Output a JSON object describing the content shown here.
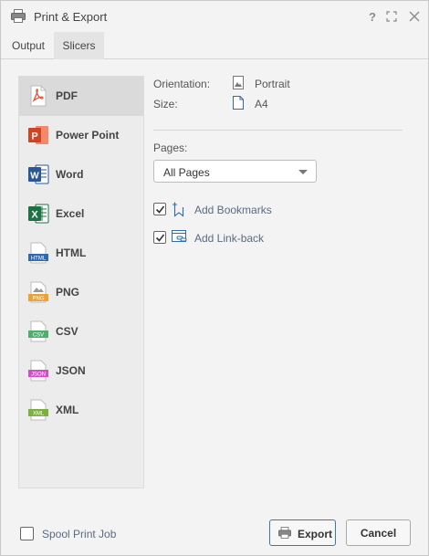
{
  "window": {
    "title": "Print & Export",
    "help_label": "?"
  },
  "tabs": [
    {
      "label": "Output"
    },
    {
      "label": "Slicers"
    }
  ],
  "formats": [
    {
      "label": "PDF",
      "icon": "pdf-icon",
      "badge": ""
    },
    {
      "label": "Power Point",
      "icon": "powerpoint-icon",
      "badge": "P"
    },
    {
      "label": "Word",
      "icon": "word-icon",
      "badge": "W"
    },
    {
      "label": "Excel",
      "icon": "excel-icon",
      "badge": "X"
    },
    {
      "label": "HTML",
      "icon": "html-icon",
      "badge": "HTML"
    },
    {
      "label": "PNG",
      "icon": "png-icon",
      "badge": "PNG"
    },
    {
      "label": "CSV",
      "icon": "csv-icon",
      "badge": "CSV"
    },
    {
      "label": "JSON",
      "icon": "json-icon",
      "badge": "JSON"
    },
    {
      "label": "XML",
      "icon": "xml-icon",
      "badge": "XML"
    }
  ],
  "options": {
    "orientation_label": "Orientation:",
    "orientation_value": "Portrait",
    "size_label": "Size:",
    "size_value": "A4",
    "pages_label": "Pages:",
    "pages_value": "All Pages",
    "bookmarks_label": "Add Bookmarks",
    "bookmarks_checked": true,
    "linkback_label": "Add Link-back",
    "linkback_checked": true
  },
  "footer": {
    "spool_label": "Spool Print Job",
    "spool_checked": false,
    "export_label": "Export",
    "cancel_label": "Cancel"
  },
  "colors": {
    "pdf": "#e8533a",
    "powerpoint": "#d04423",
    "word": "#2b5797",
    "excel": "#1e7145",
    "html": "#2d6bb3",
    "png": "#f0a030",
    "csv": "#4caf6a",
    "json": "#d04fc7",
    "xml": "#7ab03c",
    "accent": "#3b73c7"
  }
}
